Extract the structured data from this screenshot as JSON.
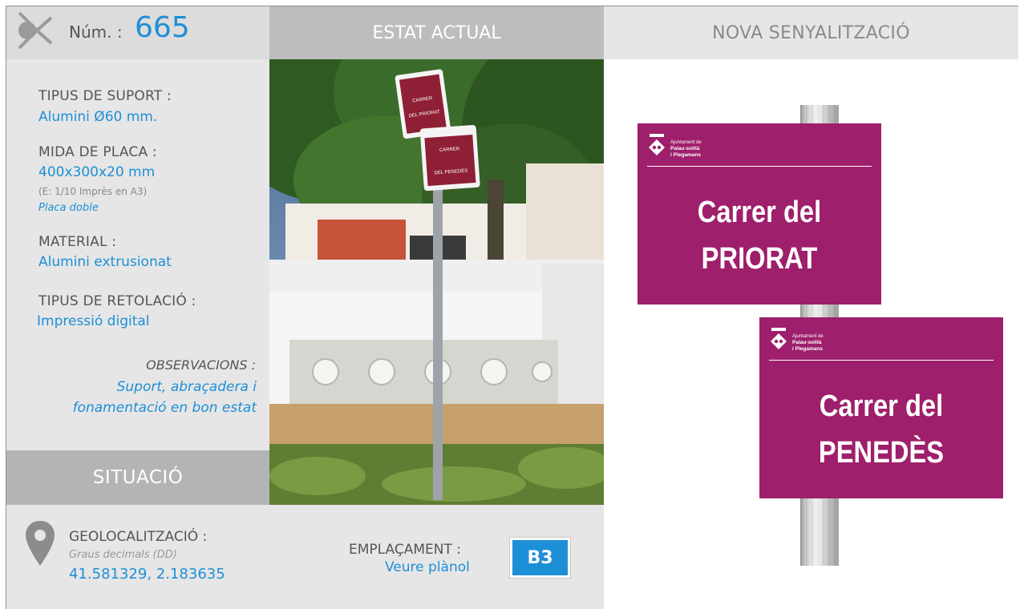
{
  "header": {
    "num_label": "Núm. :",
    "num_value": "665",
    "tab_current": "ESTAT ACTUAL",
    "tab_new": "NOVA SENYALITZACIÓ"
  },
  "fields": {
    "support_label": "TIPUS DE SUPORT :",
    "support_value": "Alumini Ø60 mm.",
    "size_label": "MIDA DE PLACA :",
    "size_value": "400x300x20 mm",
    "size_note": "(E: 1/10 Imprès en A3)",
    "size_type": "Placa doble",
    "material_label": "MATERIAL :",
    "material_value": "Alumini extrusionat",
    "lettering_label": "TIPUS DE RETOLACIÓ :",
    "lettering_value": "Impressió digital",
    "observations_label": "OBSERVACIONS :",
    "observations_line1": "Suport, abraçadera i",
    "observations_line2": "fonamentació en bon estat"
  },
  "situacio": {
    "title": "SITUACIÓ",
    "geo_label": "GEOLOCALITZACIÓ :",
    "geo_note": "Graus decimals (DD)",
    "geo_value": "41.581329, 2.183635",
    "emplacament_label": "EMPLAÇAMENT :",
    "emplacament_link": "Veure plànol",
    "emplacament_code": "B3"
  },
  "photo": {
    "sign_top_line1": "CARRER",
    "sign_top_line2": "DEL PRIORAT",
    "sign_bottom_line1": "CARRER",
    "sign_bottom_line2": "DEL PENEDÈS"
  },
  "signs": [
    {
      "brand_small": "Ajuntament de",
      "brand_line1": "Palau-solità",
      "brand_line2": "i Plegamans",
      "title_line1": "Carrer del",
      "title_line2": "PRIORAT"
    },
    {
      "brand_small": "Ajuntament de",
      "brand_line1": "Palau-solità",
      "brand_line2": "i Plegamans",
      "title_line1": "Carrer del",
      "title_line2": "PENEDÈS"
    }
  ],
  "colors": {
    "accent_blue": "#1d8fd6",
    "sign_magenta": "#9e1f6b",
    "header_gray": "#bdbdbd",
    "panel_gray": "#e6e6e6"
  },
  "icons": {
    "header": "arrow-logo-icon",
    "location": "map-pin-icon",
    "crest": "crest-icon"
  }
}
